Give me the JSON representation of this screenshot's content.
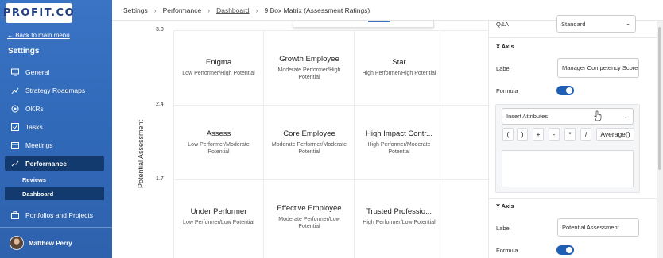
{
  "sidebar": {
    "logo": "PROFIT.CO",
    "back_link": "← Back to main menu",
    "title": "Settings",
    "items": [
      {
        "label": "General",
        "icon": "monitor-icon"
      },
      {
        "label": "Strategy Roadmaps",
        "icon": "roadmap-icon"
      },
      {
        "label": "OKRs",
        "icon": "target-icon"
      },
      {
        "label": "Tasks",
        "icon": "checkbox-icon"
      },
      {
        "label": "Meetings",
        "icon": "calendar-icon"
      },
      {
        "label": "Performance",
        "icon": "chart-icon"
      },
      {
        "label": "Portfolios and Projects",
        "icon": "briefcase-icon"
      }
    ],
    "sub_items": [
      {
        "label": "Reviews"
      },
      {
        "label": "Dashboard"
      }
    ],
    "user": "Matthew Perry"
  },
  "breadcrumb": {
    "items": [
      "Settings",
      "Performance",
      "Dashboard",
      "9 Box Matrix (Assessment Ratings)"
    ]
  },
  "chart": {
    "ylabel": "Potential Assessment",
    "yticks": [
      "3.0",
      "2.4",
      "1.7"
    ],
    "cells": [
      {
        "title": "Enigma",
        "sub": "Low Performer/High Potential"
      },
      {
        "title": "Growth Employee",
        "sub": "Moderate Performer/High Potential"
      },
      {
        "title": "Star",
        "sub": "High Performer/High Potential"
      },
      {
        "title": "Assess",
        "sub": "Low Performer/Moderate Potential"
      },
      {
        "title": "Core Employee",
        "sub": "Moderate Performer/Moderate Potential"
      },
      {
        "title": "High Impact Contr...",
        "sub": "High Performer/Moderate Potential"
      },
      {
        "title": "Under Performer",
        "sub": "Low Performer/Low Potential"
      },
      {
        "title": "Effective Employee",
        "sub": "Moderate Performer/Low Potential"
      },
      {
        "title": "Trusted Professio...",
        "sub": "High Performer/Low Potential"
      }
    ]
  },
  "panel": {
    "qa_label": "Q&A",
    "qa_value": "Standard",
    "x_axis_heading": "X Axis",
    "x_label_label": "Label",
    "x_label_value": "Manager Competency Score",
    "x_formula_label": "Formula",
    "insert_attributes": "Insert Attributes",
    "operators": [
      "(",
      ")",
      "+",
      "-",
      "*",
      "/",
      "Average()"
    ],
    "y_axis_heading": "Y Axis",
    "y_label_label": "Label",
    "y_label_value": "Potential Assessment",
    "y_formula_label": "Formula"
  },
  "colors": {
    "sidebar": "#3068b8",
    "active": "#123a6e",
    "toggle": "#1f5fb3"
  }
}
